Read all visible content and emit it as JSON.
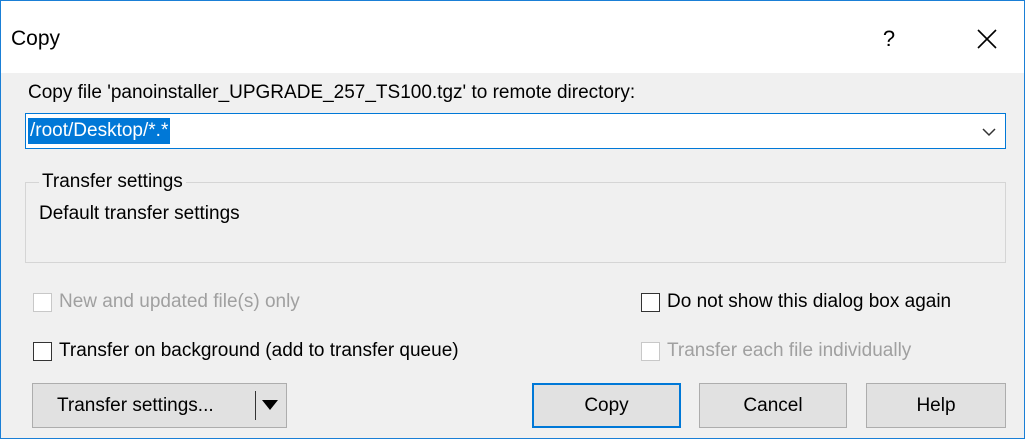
{
  "window": {
    "title": "Copy",
    "help_glyph": "?",
    "close_icon": "close-icon"
  },
  "prompt": {
    "label": "Copy file 'panoinstaller_UPGRADE_257_TS100.tgz' to remote directory:"
  },
  "target": {
    "value": "/root/Desktop/*.*",
    "dropdown_icon": "chevron-down-icon"
  },
  "transfer_group": {
    "legend": "Transfer settings",
    "text": "Default transfer settings"
  },
  "options": {
    "new_updated_only": {
      "label": "New and updated file(s) only",
      "checked": false,
      "enabled": false
    },
    "do_not_show": {
      "label": "Do not show this dialog box again",
      "checked": false,
      "enabled": true
    },
    "background": {
      "label": "Transfer on background (add to transfer queue)",
      "checked": false,
      "enabled": true
    },
    "individually": {
      "label": "Transfer each file individually",
      "checked": false,
      "enabled": false
    }
  },
  "buttons": {
    "transfer_settings": "Transfer settings...",
    "copy": "Copy",
    "cancel": "Cancel",
    "help": "Help"
  },
  "colors": {
    "accent": "#0078d7",
    "window_border": "#1a7fd6",
    "disabled_text": "#a0a0a0"
  }
}
